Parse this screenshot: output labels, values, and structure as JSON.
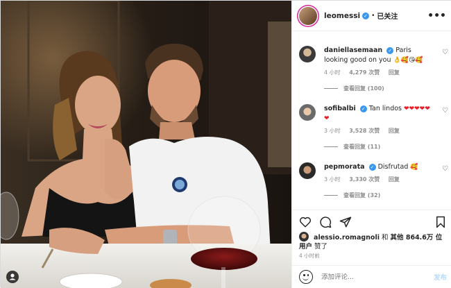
{
  "colors": {
    "accent": "#3897f0",
    "muted": "#8e8e8e",
    "heart_red": "#ed1c24",
    "post_disabled": "#b3dbff"
  },
  "photo": {
    "alt": ""
  },
  "header": {
    "username": "leomessi",
    "separator": "•",
    "follow_status": "已关注",
    "more_label": "•••"
  },
  "comments": [
    {
      "username": "daniellasemaan",
      "verified": true,
      "text": "Paris looking good on you",
      "emoji": "👌🥰😘🥰",
      "time": "4 小时",
      "likes": "4,279 次赞",
      "reply": "回复",
      "view_replies": "查看回复 (100)"
    },
    {
      "username": "sofibalbi",
      "verified": true,
      "text": "Tan lindos",
      "emoji": "❤❤❤❤❤❤",
      "time": "3 小时",
      "likes": "3,528 次赞",
      "reply": "回复",
      "view_replies": "查看回复 (11)"
    },
    {
      "username": "pepmorata",
      "verified": true,
      "text": "Disfrutad",
      "emoji": "🥰",
      "time": "3 小时",
      "likes": "3,330 次赞",
      "reply": "回复",
      "view_replies": "查看回复 (32)"
    }
  ],
  "likes": {
    "liker": "alessio.romagnoli",
    "connector": "和",
    "others": "其他 864.6万 位用户",
    "suffix": "赞了"
  },
  "time_posted": "4 小时前",
  "add_comment": {
    "placeholder": "添加评论...",
    "post_label": "发布"
  },
  "icons": [
    "heart-icon",
    "comment-icon",
    "share-icon",
    "bookmark-icon",
    "emoji-icon",
    "verified-icon",
    "more-icon"
  ]
}
